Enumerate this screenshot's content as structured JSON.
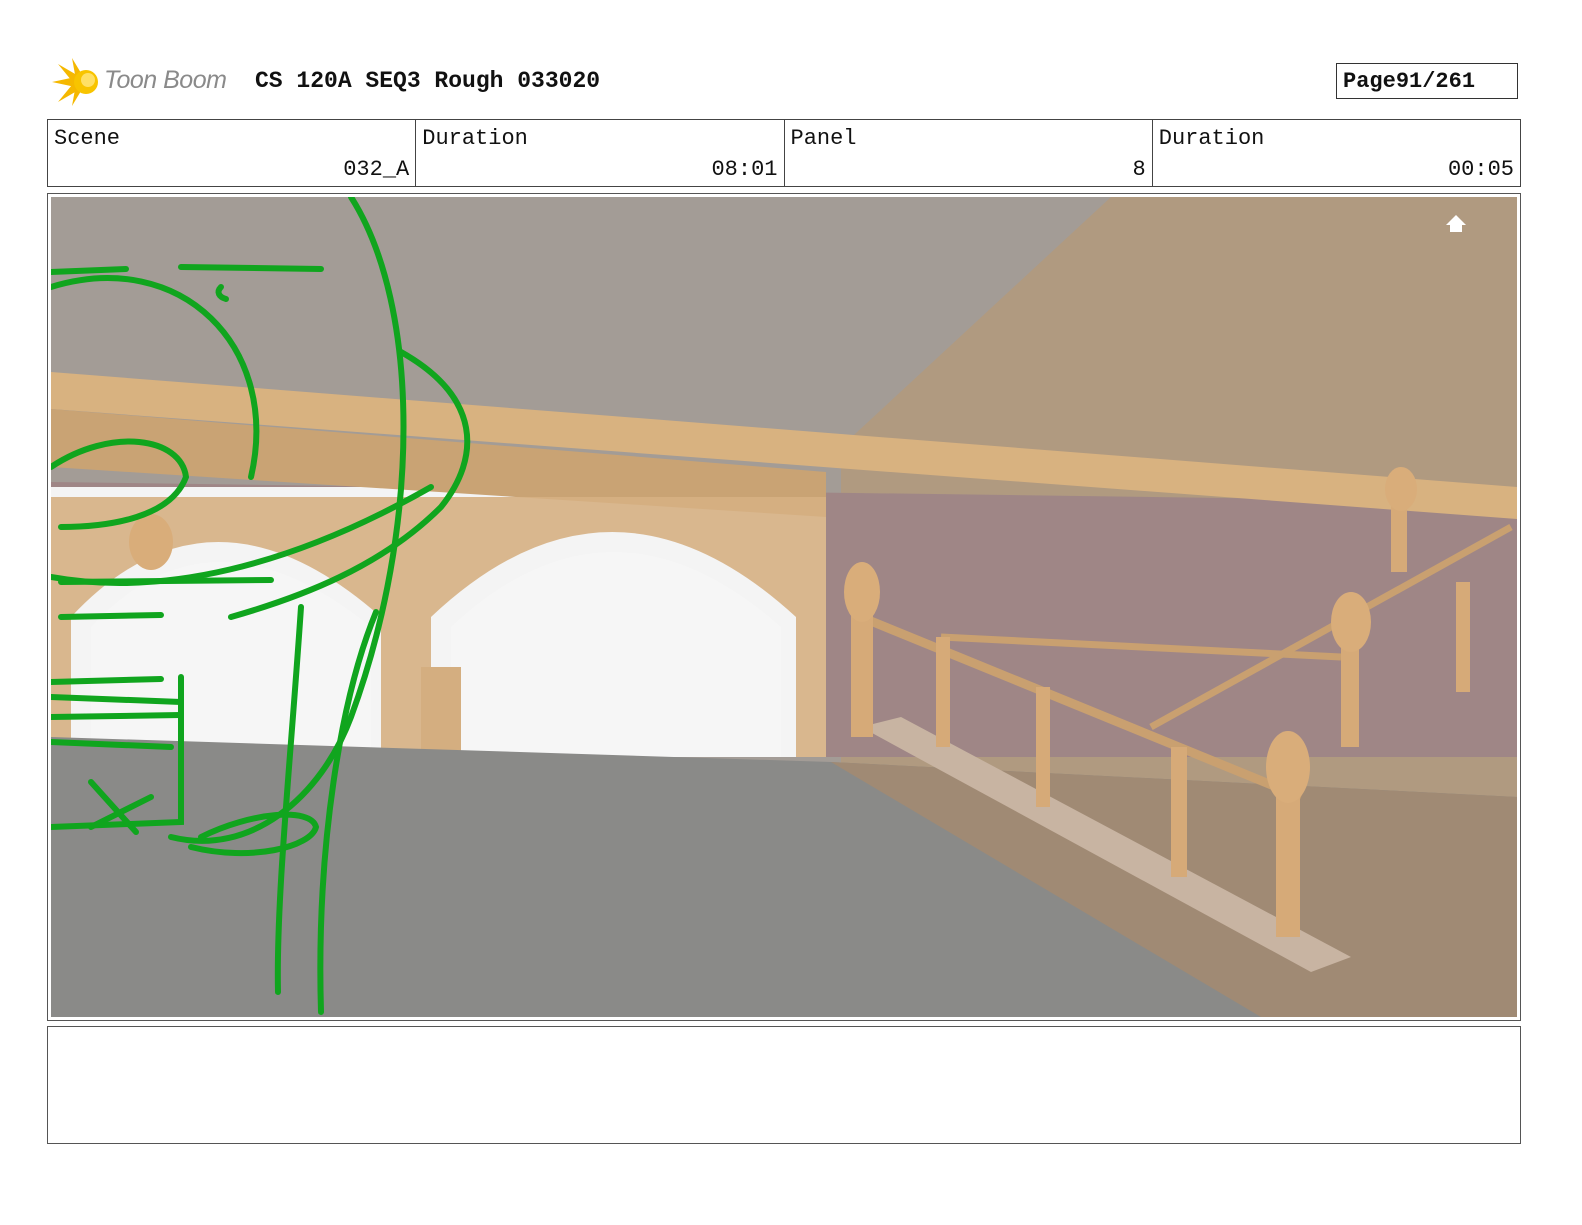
{
  "header": {
    "logo_text": "Toon Boom",
    "title": "CS 120A SEQ3 Rough 033020",
    "page_label": "Page",
    "page_value": "91/261"
  },
  "info": {
    "scene_label": "Scene",
    "scene_value": "032_A",
    "scene_duration_label": "Duration",
    "scene_duration_value": "08:01",
    "panel_label": "Panel",
    "panel_value": "8",
    "panel_duration_label": "Duration",
    "panel_duration_value": "00:05"
  },
  "panel": {
    "sketch_color": "#10a51e",
    "home_icon": "home-icon"
  },
  "notes": {
    "text": ""
  }
}
